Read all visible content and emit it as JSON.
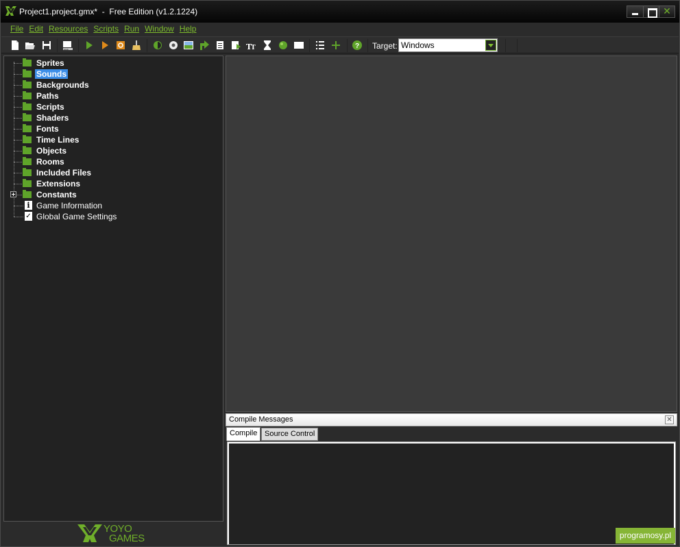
{
  "window": {
    "title": "Project1.project.gmx*  -  Free Edition (v1.2.1224)"
  },
  "menu": {
    "items": [
      "File",
      "Edit",
      "Resources",
      "Scripts",
      "Run",
      "Window",
      "Help"
    ]
  },
  "toolbar": {
    "target_label": "Target:",
    "target_value": "Windows",
    "icons": [
      "new-file-icon",
      "open-icon",
      "save-icon",
      "export-icon",
      "run-icon",
      "debug-icon",
      "stop-icon",
      "clean-icon",
      "create-sprite-icon",
      "create-sound-icon",
      "create-background-icon",
      "create-path-icon",
      "create-script-icon",
      "create-shader-icon",
      "create-font-icon",
      "create-timeline-icon",
      "create-object-icon",
      "create-room-icon",
      "game-settings-icon",
      "extensions-icon",
      "help-icon"
    ]
  },
  "tree": {
    "items": [
      {
        "label": "Sprites",
        "type": "folder"
      },
      {
        "label": "Sounds",
        "type": "folder",
        "selected": true
      },
      {
        "label": "Backgrounds",
        "type": "folder"
      },
      {
        "label": "Paths",
        "type": "folder"
      },
      {
        "label": "Scripts",
        "type": "folder"
      },
      {
        "label": "Shaders",
        "type": "folder"
      },
      {
        "label": "Fonts",
        "type": "folder"
      },
      {
        "label": "Time Lines",
        "type": "folder"
      },
      {
        "label": "Objects",
        "type": "folder"
      },
      {
        "label": "Rooms",
        "type": "folder"
      },
      {
        "label": "Included Files",
        "type": "folder"
      },
      {
        "label": "Extensions",
        "type": "folder"
      },
      {
        "label": "Constants",
        "type": "folder",
        "expandable": true
      },
      {
        "label": "Game Information",
        "type": "info"
      },
      {
        "label": "Global Game Settings",
        "type": "settings"
      }
    ]
  },
  "logo": {
    "line1": "YOYO",
    "line2": "GAMES"
  },
  "compile": {
    "title": "Compile Messages",
    "tabs": [
      "Compile",
      "Source Control"
    ]
  },
  "watermark": "programosy.pl",
  "colors": {
    "accent_green": "#6fae2a",
    "selection_blue": "#3c8ee8",
    "panel_dark": "#222222"
  }
}
